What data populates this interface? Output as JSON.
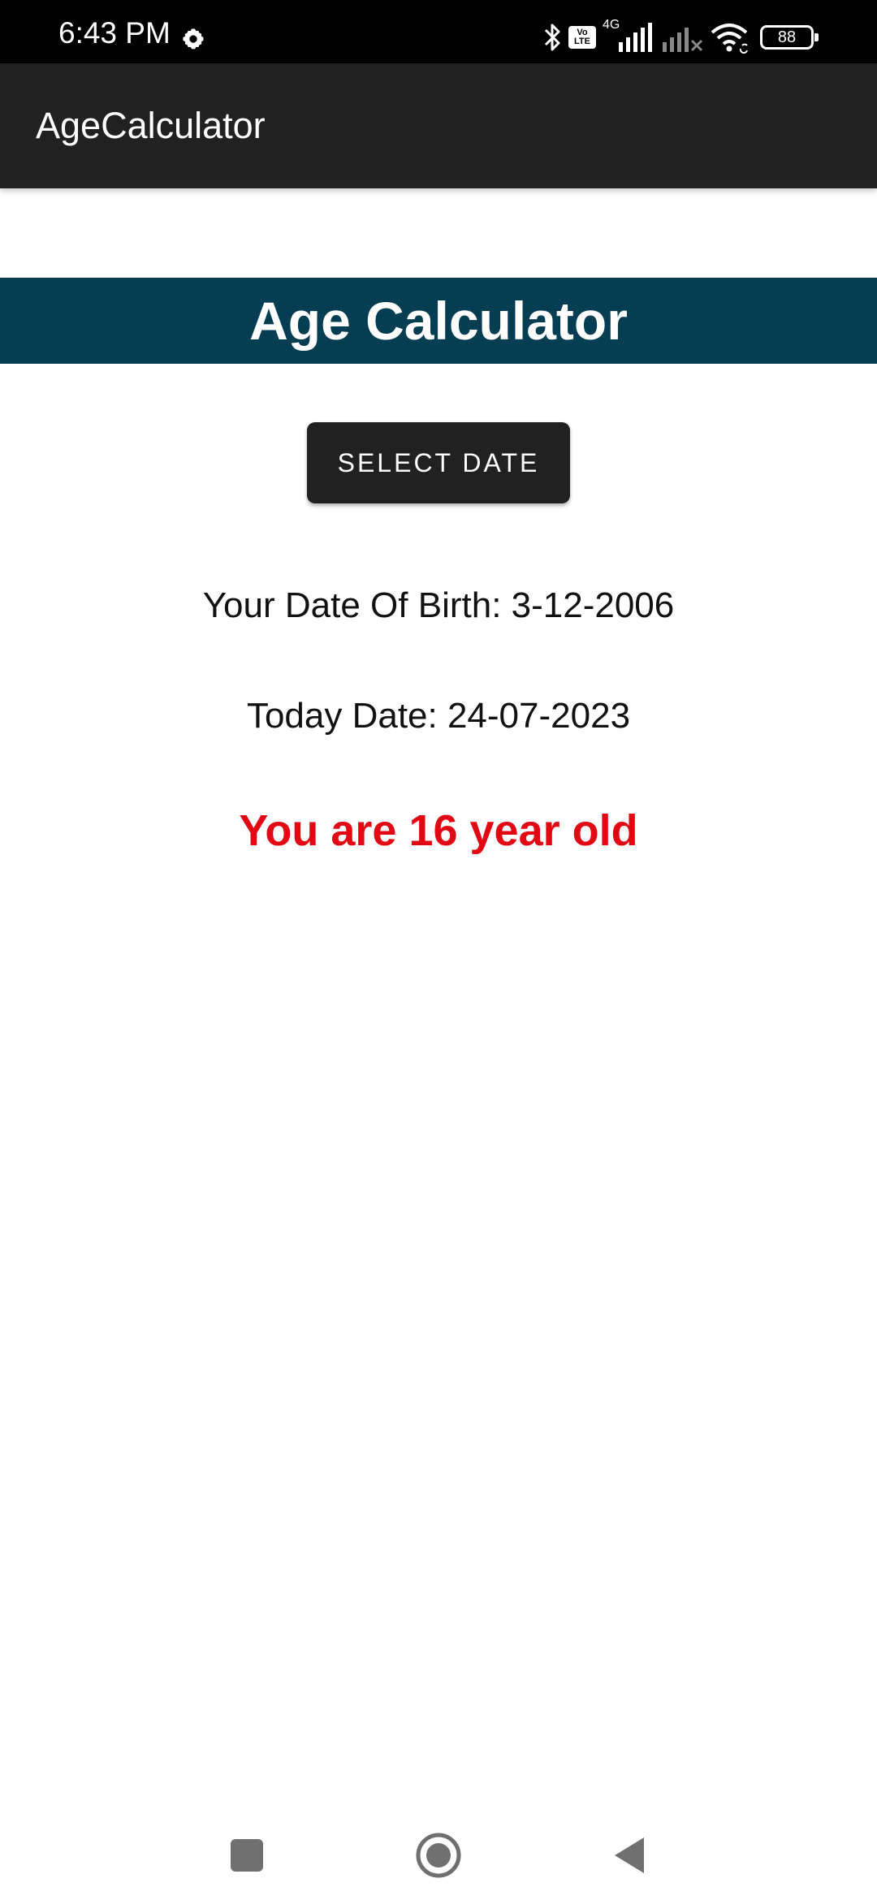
{
  "status_bar": {
    "time": "6:43 PM",
    "volte_top": "Vo",
    "volte_bottom": "LTE",
    "network": "4G",
    "battery": "88",
    "icons": [
      "settings-gear-icon",
      "bluetooth-icon",
      "volte-icon",
      "signal-4g-icon",
      "signal-no-sim-icon",
      "wifi-icon",
      "battery-icon"
    ]
  },
  "app_bar": {
    "title": "AgeCalculator"
  },
  "main": {
    "heading": "Age Calculator",
    "select_button_label": "SELECT DATE",
    "dob_line": "Your Date Of Birth: 3-12-2006",
    "today_line": "Today Date: 24-07-2023",
    "result_line": "You are 16 year old"
  },
  "nav_bar": {
    "icons": [
      "recents-square-icon",
      "home-circle-icon",
      "back-triangle-icon"
    ]
  },
  "colors": {
    "status_bar": "#000000",
    "app_bar": "#212121",
    "heading_band": "#053d52",
    "button": "#212121",
    "result_text": "#e30613"
  }
}
